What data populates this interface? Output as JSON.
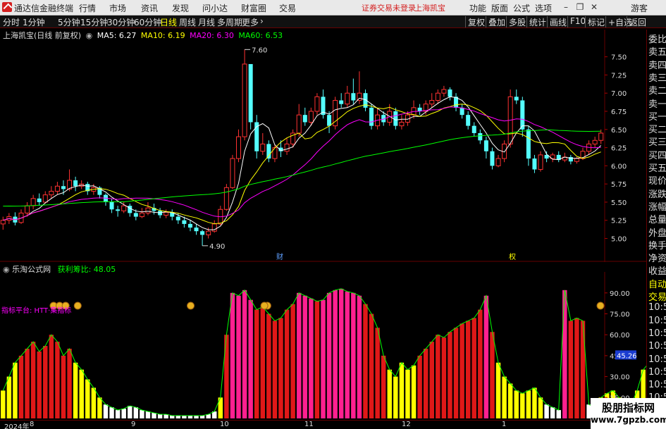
{
  "titlebar": {
    "app_name": "通达信金融终端",
    "menus": [
      "行情",
      "市场",
      "资讯",
      "发现",
      "问小达",
      "财富圈",
      "交易"
    ],
    "warning": "证券交易未登录",
    "stock": "上海凯宝",
    "right_menus": [
      "功能",
      "版面",
      "公式",
      "选项"
    ],
    "guest": "游客"
  },
  "toolbar": {
    "periods": [
      "分时",
      "1分钟",
      "5分钟",
      "15分钟",
      "30分钟",
      "60分钟",
      "日线",
      "周线",
      "月线",
      "多周期",
      "更多"
    ],
    "active_period": "日线",
    "right_tools": [
      "复权",
      "叠加",
      "多股",
      "统计",
      "画线",
      "F10",
      "标记",
      "+自选",
      "返回"
    ]
  },
  "main_legend": {
    "title": "上海凯宝(日线 前复权)",
    "ma5": "MA5: 6.27",
    "ma10": "MA10: 6.19",
    "ma20": "MA20: 6.30",
    "ma60": "MA60: 6.53"
  },
  "sub_legend": {
    "title": "乐淘公式网",
    "metric": "获利筹比: 48.05",
    "platform_label": "指标平台: HTT·集指标"
  },
  "colors": {
    "up": "#ff3232",
    "down": "#54ffff",
    "ma5": "#ffffff",
    "ma10": "#ffff00",
    "ma20": "#ff00ff",
    "ma60": "#00ff00",
    "bar_white": "#ffffff",
    "bar_yellow": "#ffff00",
    "bar_red": "#e01818",
    "bar_magenta": "#ff2090"
  },
  "price_axis": {
    "ticks": [
      "7.50",
      "7.25",
      "7.00",
      "6.75",
      "6.50",
      "6.25",
      "6.00",
      "5.75",
      "5.50",
      "5.25",
      "5.00"
    ]
  },
  "sub_axis": {
    "ticks": [
      "90.00",
      "75.00",
      "60.00",
      "45.00",
      "30.00",
      "15.00"
    ],
    "current": "45.26"
  },
  "annotations": {
    "high": "7.60",
    "low": "4.90",
    "marker_cai": "财",
    "marker_ji": "权"
  },
  "time_axis": {
    "labels": [
      "2024年",
      "8",
      "9",
      "10",
      "11",
      "12",
      "1"
    ]
  },
  "side_panel": {
    "items": [
      "委比",
      "卖五",
      "卖四",
      "卖三",
      "卖二",
      "卖一",
      "买一",
      "买二",
      "买三",
      "买四",
      "买五",
      "现价",
      "涨跌",
      "涨幅",
      "总量",
      "外盘",
      "换手",
      "净资",
      "收益",
      "自动",
      "交易",
      "10:54",
      "10:54",
      "10:54",
      "10:54",
      "10:54",
      "10:55",
      "10:55",
      "10:55"
    ]
  },
  "watermark": {
    "line1": "股朋指标网",
    "line2": "www.7gpzb.com"
  },
  "chart_data": {
    "type": "candlestick",
    "ylim": [
      4.85,
      7.7
    ],
    "candles": [
      [
        5.2,
        5.25,
        5.12,
        5.3
      ],
      [
        5.25,
        5.3,
        5.2,
        5.35
      ],
      [
        5.3,
        5.22,
        5.18,
        5.36
      ],
      [
        5.22,
        5.35,
        5.2,
        5.4
      ],
      [
        5.35,
        5.45,
        5.3,
        5.5
      ],
      [
        5.45,
        5.55,
        5.4,
        5.6
      ],
      [
        5.55,
        5.5,
        5.45,
        5.62
      ],
      [
        5.5,
        5.6,
        5.48,
        5.65
      ],
      [
        5.6,
        5.65,
        5.55,
        5.72
      ],
      [
        5.65,
        5.72,
        5.6,
        5.78
      ],
      [
        5.72,
        5.68,
        5.6,
        5.8
      ],
      [
        5.68,
        5.8,
        5.65,
        5.95
      ],
      [
        5.8,
        5.72,
        5.65,
        5.85
      ],
      [
        5.72,
        5.75,
        5.68,
        5.8
      ],
      [
        5.75,
        5.65,
        5.6,
        5.78
      ],
      [
        5.65,
        5.7,
        5.6,
        5.75
      ],
      [
        5.7,
        5.6,
        5.55,
        5.72
      ],
      [
        5.6,
        5.5,
        5.45,
        5.62
      ],
      [
        5.5,
        5.4,
        5.35,
        5.55
      ],
      [
        5.4,
        5.38,
        5.3,
        5.45
      ],
      [
        5.38,
        5.45,
        5.35,
        5.5
      ],
      [
        5.45,
        5.35,
        5.3,
        5.48
      ],
      [
        5.35,
        5.3,
        5.25,
        5.4
      ],
      [
        5.3,
        5.35,
        5.28,
        5.42
      ],
      [
        5.35,
        5.42,
        5.32,
        5.5
      ],
      [
        5.42,
        5.38,
        5.33,
        5.48
      ],
      [
        5.38,
        5.32,
        5.28,
        5.42
      ],
      [
        5.32,
        5.36,
        5.28,
        5.4
      ],
      [
        5.36,
        5.3,
        5.25,
        5.4
      ],
      [
        5.3,
        5.25,
        5.2,
        5.35
      ],
      [
        5.25,
        5.2,
        5.15,
        5.3
      ],
      [
        5.2,
        5.15,
        5.1,
        5.25
      ],
      [
        5.15,
        5.1,
        5.05,
        5.2
      ],
      [
        5.1,
        5.05,
        4.9,
        5.12
      ],
      [
        5.05,
        5.1,
        5.0,
        5.15
      ],
      [
        5.1,
        5.2,
        5.08,
        5.25
      ],
      [
        5.2,
        5.4,
        5.18,
        5.45
      ],
      [
        5.4,
        5.7,
        5.38,
        5.75
      ],
      [
        5.7,
        6.1,
        5.68,
        6.15
      ],
      [
        6.1,
        6.4,
        6.05,
        6.5
      ],
      [
        6.4,
        7.4,
        6.35,
        7.6
      ],
      [
        7.4,
        6.6,
        6.5,
        7.2
      ],
      [
        6.6,
        6.2,
        6.1,
        6.7
      ],
      [
        6.2,
        6.3,
        6.15,
        6.45
      ],
      [
        6.3,
        6.1,
        6.05,
        6.35
      ],
      [
        6.1,
        6.25,
        6.05,
        6.3
      ],
      [
        6.25,
        6.2,
        6.12,
        6.35
      ],
      [
        6.2,
        6.3,
        6.15,
        6.38
      ],
      [
        6.3,
        6.45,
        6.25,
        6.5
      ],
      [
        6.45,
        6.7,
        6.4,
        6.85
      ],
      [
        6.7,
        6.6,
        6.55,
        6.8
      ],
      [
        6.6,
        6.75,
        6.55,
        6.8
      ],
      [
        6.75,
        6.95,
        6.7,
        7.0
      ],
      [
        6.95,
        6.7,
        6.65,
        7.05
      ],
      [
        6.7,
        6.55,
        6.45,
        6.75
      ],
      [
        6.55,
        6.9,
        6.5,
        6.95
      ],
      [
        6.9,
        6.85,
        6.8,
        7.0
      ],
      [
        6.85,
        7.0,
        6.8,
        7.1
      ],
      [
        7.0,
        6.9,
        6.85,
        7.2
      ],
      [
        6.9,
        7.0,
        6.85,
        7.3
      ],
      [
        7.0,
        6.8,
        6.75,
        7.05
      ],
      [
        6.8,
        6.55,
        6.5,
        6.85
      ],
      [
        6.55,
        6.7,
        6.5,
        6.8
      ],
      [
        6.7,
        6.6,
        6.55,
        6.75
      ],
      [
        6.6,
        6.75,
        6.55,
        6.85
      ],
      [
        6.75,
        6.55,
        6.5,
        6.8
      ],
      [
        6.55,
        6.6,
        6.5,
        6.7
      ],
      [
        6.6,
        6.7,
        6.55,
        6.75
      ],
      [
        6.7,
        6.8,
        6.65,
        6.9
      ],
      [
        6.8,
        6.75,
        6.7,
        6.85
      ],
      [
        6.75,
        6.85,
        6.7,
        6.9
      ],
      [
        6.85,
        6.9,
        6.8,
        7.0
      ],
      [
        6.9,
        7.0,
        6.85,
        7.05
      ],
      [
        7.0,
        7.05,
        6.95,
        7.1
      ],
      [
        7.05,
        6.95,
        6.9,
        7.08
      ],
      [
        6.95,
        6.8,
        6.75,
        7.0
      ],
      [
        6.8,
        6.7,
        6.65,
        6.85
      ],
      [
        6.7,
        6.55,
        6.5,
        6.75
      ],
      [
        6.55,
        6.45,
        6.4,
        6.6
      ],
      [
        6.45,
        6.35,
        6.3,
        6.5
      ],
      [
        6.35,
        6.2,
        6.1,
        6.4
      ],
      [
        6.2,
        6.0,
        5.95,
        6.25
      ],
      [
        6.0,
        6.1,
        5.98,
        6.15
      ],
      [
        6.1,
        6.3,
        6.05,
        6.35
      ],
      [
        6.3,
        6.95,
        6.25,
        7.05
      ],
      [
        6.95,
        6.9,
        6.85,
        7.05
      ],
      [
        6.9,
        6.5,
        6.4,
        6.95
      ],
      [
        6.5,
        6.1,
        6.0,
        6.55
      ],
      [
        6.1,
        5.95,
        5.9,
        6.15
      ],
      [
        5.95,
        6.15,
        5.92,
        6.2
      ],
      [
        6.15,
        6.1,
        6.05,
        6.2
      ],
      [
        6.1,
        6.15,
        6.05,
        6.18
      ],
      [
        6.15,
        6.08,
        6.05,
        6.2
      ],
      [
        6.08,
        6.12,
        6.05,
        6.18
      ],
      [
        6.12,
        6.06,
        6.02,
        6.15
      ],
      [
        6.06,
        6.1,
        6.03,
        6.12
      ],
      [
        6.1,
        6.2,
        6.08,
        6.25
      ],
      [
        6.2,
        6.3,
        6.15,
        6.35
      ],
      [
        6.3,
        6.35,
        6.25,
        6.4
      ],
      [
        6.35,
        6.45,
        6.3,
        6.5
      ]
    ],
    "sub_values": [
      20,
      30,
      40,
      45,
      50,
      55,
      48,
      52,
      60,
      55,
      45,
      50,
      40,
      35,
      28,
      22,
      15,
      10,
      8,
      6,
      7,
      9,
      8,
      6,
      5,
      4,
      3,
      3,
      2,
      2,
      2,
      2,
      2,
      2,
      3,
      5,
      15,
      60,
      90,
      88,
      92,
      85,
      78,
      80,
      75,
      70,
      72,
      78,
      82,
      90,
      88,
      86,
      84,
      85,
      90,
      92,
      93,
      91,
      90,
      88,
      82,
      75,
      65,
      45,
      35,
      30,
      40,
      35,
      38,
      45,
      50,
      55,
      60,
      58,
      62,
      65,
      68,
      70,
      72,
      78,
      88,
      62,
      40,
      30,
      25,
      20,
      18,
      20,
      22,
      15,
      10,
      8,
      6,
      92,
      70,
      72,
      70,
      10,
      8,
      15,
      18,
      20,
      15,
      12,
      10,
      20,
      35,
      40,
      45,
      48
    ]
  }
}
